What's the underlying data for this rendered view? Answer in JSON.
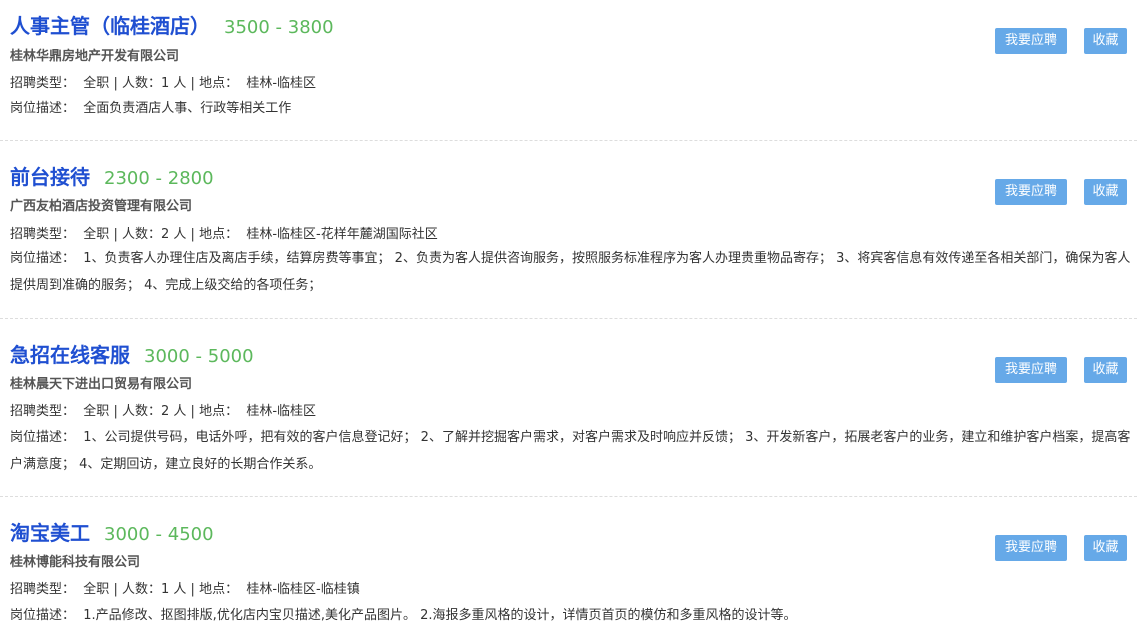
{
  "jobs": [
    {
      "title": "人事主管（临桂酒店）",
      "salary": "3500 - 3800",
      "company": "桂林华鼎房地产开发有限公司",
      "type_label": "招聘类型：",
      "type": "全职",
      "count_label": "人数：",
      "count": "1 人",
      "location_label": "地点：",
      "location": "桂林-临桂区",
      "desc_label": "岗位描述：",
      "desc": "全面负责酒店人事、行政等相关工作",
      "apply_label": "我要应聘",
      "save_label": "收藏"
    },
    {
      "title": "前台接待",
      "salary": "2300 - 2800",
      "company": "广西友柏酒店投资管理有限公司",
      "type_label": "招聘类型：",
      "type": "全职",
      "count_label": "人数：",
      "count": "2 人",
      "location_label": "地点：",
      "location": "桂林-临桂区-花样年麓湖国际社区",
      "desc_label": "岗位描述：",
      "desc": "1、负责客人办理住店及离店手续，结算房费等事宜； 2、负责为客人提供咨询服务，按照服务标准程序为客人办理贵重物品寄存； 3、将宾客信息有效传递至各相关部门，确保为客人提供周到准确的服务； 4、完成上级交给的各项任务；",
      "apply_label": "我要应聘",
      "save_label": "收藏"
    },
    {
      "title": "急招在线客服",
      "salary": "3000 - 5000",
      "company": "桂林晨天下进出口贸易有限公司",
      "type_label": "招聘类型：",
      "type": "全职",
      "count_label": "人数：",
      "count": "2 人",
      "location_label": "地点：",
      "location": "桂林-临桂区",
      "desc_label": "岗位描述：",
      "desc": "1、公司提供号码，电话外呼，把有效的客户信息登记好； 2、了解并挖掘客户需求，对客户需求及时响应并反馈； 3、开发新客户，拓展老客户的业务，建立和维护客户档案，提高客户满意度； 4、定期回访，建立良好的长期合作关系。",
      "apply_label": "我要应聘",
      "save_label": "收藏"
    },
    {
      "title": "淘宝美工",
      "salary": "3000 - 4500",
      "company": "桂林博能科技有限公司",
      "type_label": "招聘类型：",
      "type": "全职",
      "count_label": "人数：",
      "count": "1 人",
      "location_label": "地点：",
      "location": "桂林-临桂区-临桂镇",
      "desc_label": "岗位描述：",
      "desc": "1.产品修改、抠图排版,优化店内宝贝描述,美化产品图片。 2.海报多重风格的设计，详情页首页的模仿和多重风格的设计等。",
      "apply_label": "我要应聘",
      "save_label": "收藏"
    }
  ]
}
